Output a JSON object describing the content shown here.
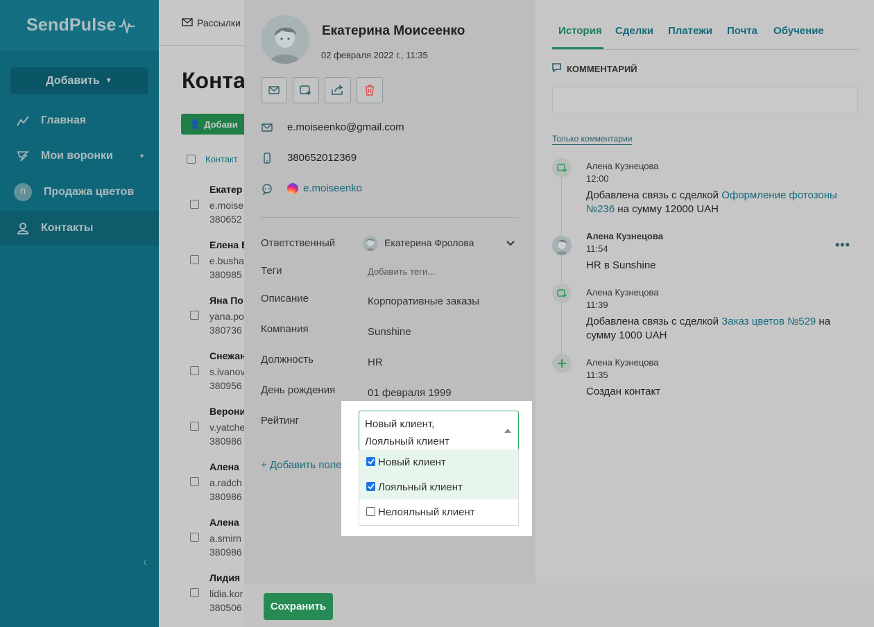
{
  "brand": "SendPulse",
  "sidebar": {
    "add_label": "Добавить",
    "items": [
      {
        "label": "Главная"
      },
      {
        "label": "Мои воронки"
      },
      {
        "label": "Продажа цветов",
        "badge": "П"
      },
      {
        "label": "Контакты"
      }
    ]
  },
  "page": {
    "topbar_label": "Рассылки",
    "title": "Конта",
    "add_contact": "Добави",
    "list_header": "Контакт",
    "rows": [
      {
        "name": "Екатер",
        "email": "e.moise",
        "phone": "380652"
      },
      {
        "name": "Елена Б",
        "email": "e.busha",
        "phone": "380985"
      },
      {
        "name": "Яна По",
        "email": "yana.po",
        "phone": "380736"
      },
      {
        "name": "Снежан",
        "email": "s.ivanov",
        "phone": "380956"
      },
      {
        "name": "Верони",
        "email": "v.yatche",
        "phone": "380986"
      },
      {
        "name": "Алена",
        "email": "a.radch",
        "phone": "380986"
      },
      {
        "name": "Алена",
        "email": "a.smirn",
        "phone": "380986"
      },
      {
        "name": "Лидия",
        "email": "lidia.kor",
        "phone": "380506"
      }
    ]
  },
  "contact": {
    "name": "Екатерина Моисеенко",
    "created": "02 февраля 2022 г., 11:35",
    "email": "e.moiseenko@gmail.com",
    "phone": "380652012369",
    "instagram": "e.moiseenko",
    "fields": {
      "responsible_label": "Ответственный",
      "responsible_value": "Екатерина Фролова",
      "tags_label": "Теги",
      "tags_placeholder": "Добавить теги...",
      "description_label": "Описание",
      "description_value": "Корпоративные заказы",
      "company_label": "Компания",
      "company_value": "Sunshine",
      "position_label": "Должность",
      "position_value": "HR",
      "birthday_label": "День рождения",
      "birthday_value": "01 февраля 1999",
      "rating_label": "Рейтинг"
    },
    "add_field": "+ Добавить поле"
  },
  "rating": {
    "selected_line1": "Новый клиент,",
    "selected_line2": "Лояльный клиент",
    "options": [
      {
        "label": "Новый клиент",
        "checked": true
      },
      {
        "label": "Лояльный клиент",
        "checked": true
      },
      {
        "label": "Нелояльный клиент",
        "checked": false
      }
    ]
  },
  "tabs": [
    "История",
    "Сделки",
    "Платежи",
    "Почта",
    "Обучение"
  ],
  "comments": {
    "title": "КОММЕНТАРИЙ",
    "only_comments": "Только комментарии"
  },
  "timeline": [
    {
      "author": "Алена Кузнецова",
      "time": "12:00",
      "text_before": "Добавлена связь с сделкой ",
      "link": "Оформление фотозоны №236",
      "text_after": " на сумму 12000 UAH",
      "icon": "deal-link-icon"
    },
    {
      "author": "Алена Кузнецова",
      "time": "11:54",
      "text": "HR в Sunshine",
      "icon": "user-avatar"
    },
    {
      "author": "Алена Кузнецова",
      "time": "11:39",
      "text_before": "Добавлена связь с сделкой ",
      "link": "Заказ цветов №529",
      "text_after": " на сумму 1000 UAH",
      "icon": "deal-link-icon"
    },
    {
      "author": "Алена Кузнецова",
      "time": "11:35",
      "text": "Создан контакт",
      "icon": "plus-icon"
    }
  ],
  "footer": {
    "save": "Сохранить"
  },
  "colors": {
    "sidebar": "#14839a",
    "accent_green": "#2fa85e",
    "link": "#156a7c"
  }
}
